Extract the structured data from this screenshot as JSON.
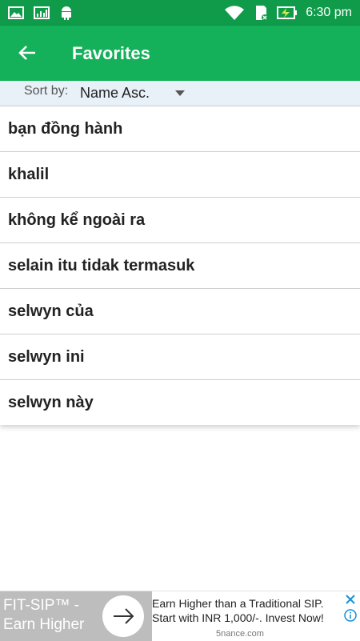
{
  "status_bar": {
    "time": "6:30 pm",
    "icons": [
      "gallery-icon",
      "chart-icon",
      "android-icon",
      "wifi-icon",
      "sd-card-icon",
      "battery-charging-icon"
    ]
  },
  "app_bar": {
    "title": "Favorites",
    "back_icon": "arrow-back-icon"
  },
  "sort": {
    "label": "Sort by:",
    "selected": "Name Asc."
  },
  "favorites": [
    "bạn đồng hành",
    "khalil",
    "không kể ngoài ra",
    "selain itu tidak termasuk",
    "selwyn của",
    "selwyn ini",
    "selwyn này"
  ],
  "ad": {
    "brand": "FIT-SIP™ - Earn Higher",
    "text": "Earn Higher than a Traditional SIP. Start with INR 1,000/-. Invest Now!",
    "domain": "5nance.com"
  },
  "colors": {
    "status_bar": "#0f9b4a",
    "app_bar": "#14b05a",
    "sort_bar": "#e8f1f8"
  }
}
